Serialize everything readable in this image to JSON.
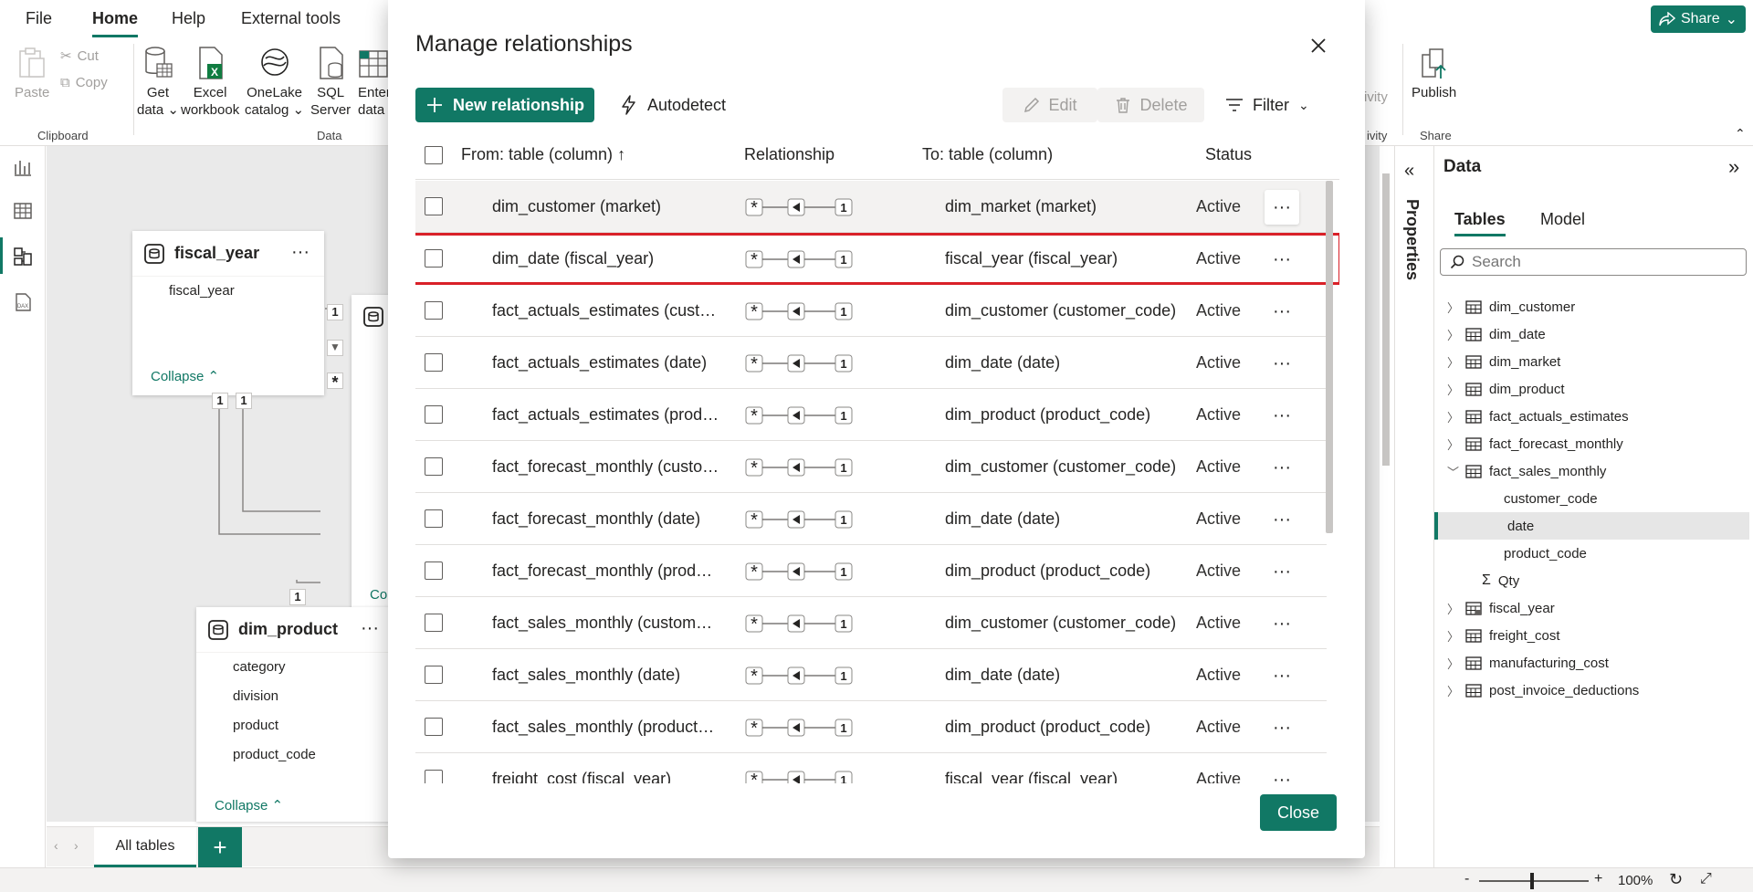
{
  "menu": {
    "file": "File",
    "home": "Home",
    "help": "Help",
    "external_tools": "External tools",
    "share": "Share"
  },
  "ribbon": {
    "paste": "Paste",
    "cut": "Cut",
    "copy": "Copy",
    "clipboard": "Clipboard",
    "get_data": [
      "Get",
      "data"
    ],
    "excel": [
      "Excel",
      "workbook"
    ],
    "onelake": [
      "OneLake",
      "catalog"
    ],
    "sql": [
      "SQL",
      "Server"
    ],
    "enter": [
      "Enter",
      "data"
    ],
    "data_group": "Data",
    "activity_fragment": "ivity",
    "activity_group_fragment": "ivity",
    "publish": "Publish",
    "share_group": "Share"
  },
  "canvas": {
    "fiscal_year_card": {
      "title": "fiscal_year",
      "fields": [
        "fiscal_year"
      ],
      "collapse": "Collapse"
    },
    "hidden_card_collapse_fragment": "Co",
    "dim_product_card": {
      "title": "dim_product",
      "fields": [
        "category",
        "division",
        "product",
        "product_code"
      ],
      "collapse": "Collapse"
    },
    "badges": {
      "one": "1",
      "many": "*"
    },
    "tab_all": "All tables",
    "tab_add": "+"
  },
  "status_bar": {
    "zoom": "100%"
  },
  "properties": {
    "label": "Properties"
  },
  "data_pane": {
    "title": "Data",
    "tab_tables": "Tables",
    "tab_model": "Model",
    "search_placeholder": "Search",
    "tables": [
      {
        "name": "dim_customer",
        "expanded": false
      },
      {
        "name": "dim_date",
        "expanded": false
      },
      {
        "name": "dim_market",
        "expanded": false
      },
      {
        "name": "dim_product",
        "expanded": false
      },
      {
        "name": "fact_actuals_estimates",
        "expanded": false
      },
      {
        "name": "fact_forecast_monthly",
        "expanded": false
      },
      {
        "name": "fact_sales_monthly",
        "expanded": true
      },
      {
        "name": "customer_code",
        "child": true
      },
      {
        "name": "date",
        "child": true,
        "selected": true
      },
      {
        "name": "product_code",
        "child": true
      },
      {
        "name": "Qty",
        "child": true,
        "measure": true
      },
      {
        "name": "fiscal_year",
        "expanded": false,
        "calendar": true
      },
      {
        "name": "freight_cost",
        "expanded": false
      },
      {
        "name": "manufacturing_cost",
        "expanded": false
      },
      {
        "name": "post_invoice_deductions",
        "expanded": false
      }
    ]
  },
  "modal": {
    "title": "Manage relationships",
    "new_relationship": "New relationship",
    "autodetect": "Autodetect",
    "edit": "Edit",
    "delete": "Delete",
    "filter": "Filter",
    "close": "Close",
    "columns": {
      "from": "From: table (column)",
      "relationship": "Relationship",
      "to": "To: table (column)",
      "status": "Status"
    },
    "relationship_glyph": {
      "many": "*",
      "one": "1"
    },
    "rows": [
      {
        "from": "dim_customer (market)",
        "to": "dim_market (market)",
        "status": "Active"
      },
      {
        "from": "dim_date (fiscal_year)",
        "to": "fiscal_year (fiscal_year)",
        "status": "Active"
      },
      {
        "from": "fact_actuals_estimates (customer_code)",
        "to": "dim_customer (customer_code)",
        "status": "Active"
      },
      {
        "from": "fact_actuals_estimates (date)",
        "to": "dim_date (date)",
        "status": "Active"
      },
      {
        "from": "fact_actuals_estimates (product_code)",
        "to": "dim_product (product_code)",
        "status": "Active"
      },
      {
        "from": "fact_forecast_monthly (customer_code)",
        "to": "dim_customer (customer_code)",
        "status": "Active"
      },
      {
        "from": "fact_forecast_monthly (date)",
        "to": "dim_date (date)",
        "status": "Active"
      },
      {
        "from": "fact_forecast_monthly (product_code)",
        "to": "dim_product (product_code)",
        "status": "Active"
      },
      {
        "from": "fact_sales_monthly (customer_code)",
        "to": "dim_customer (customer_code)",
        "status": "Active"
      },
      {
        "from": "fact_sales_monthly (date)",
        "to": "dim_date (date)",
        "status": "Active"
      },
      {
        "from": "fact_sales_monthly (product_code)",
        "to": "dim_product (product_code)",
        "status": "Active"
      },
      {
        "from": "freight_cost (fiscal_year)",
        "to": "fiscal_year (fiscal_year)",
        "status": "Active"
      }
    ],
    "more_glyph": "···"
  },
  "colors": {
    "accent": "#117865",
    "highlight": "#d92028"
  }
}
